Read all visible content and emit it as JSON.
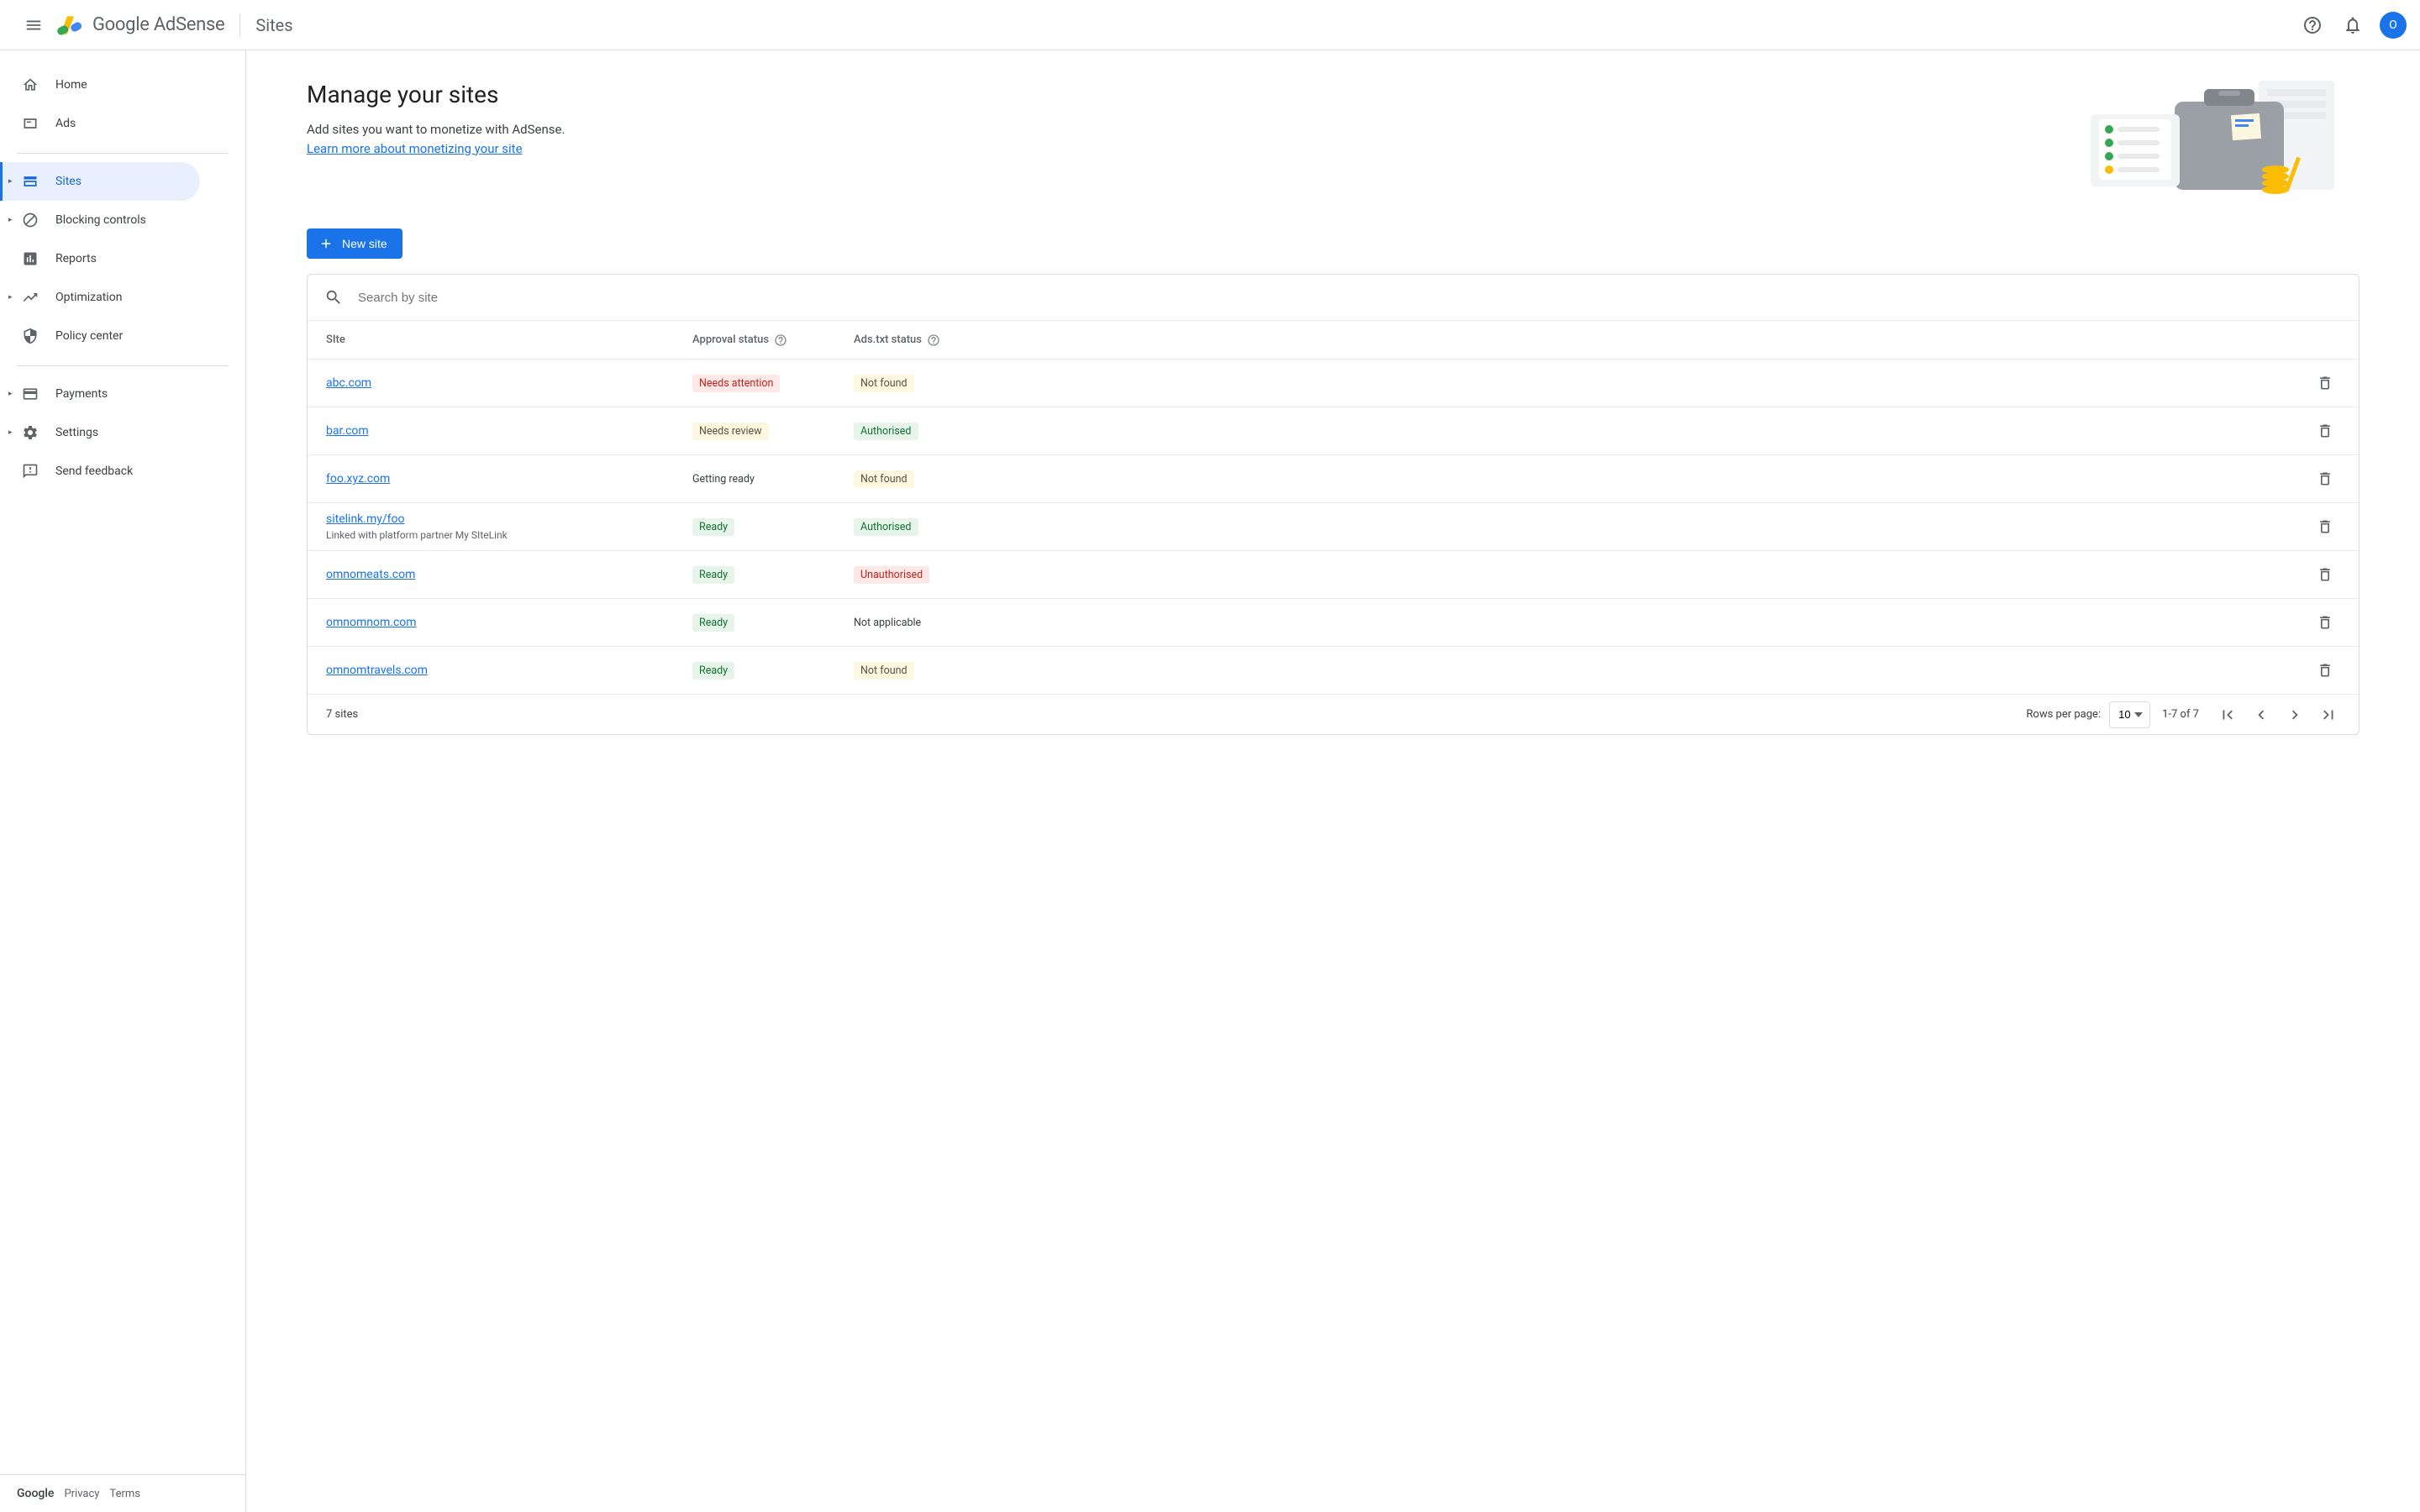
{
  "header": {
    "product_google": "Google",
    "product_name": "AdSense",
    "section": "Sites",
    "avatar_letter": "O"
  },
  "sidebar": {
    "items": [
      {
        "label": "Home"
      },
      {
        "label": "Ads"
      },
      {
        "label": "Sites"
      },
      {
        "label": "Blocking controls"
      },
      {
        "label": "Reports"
      },
      {
        "label": "Optimization"
      },
      {
        "label": "Policy center"
      },
      {
        "label": "Payments"
      },
      {
        "label": "Settings"
      },
      {
        "label": "Send feedback"
      }
    ],
    "footer": {
      "google": "Google",
      "privacy": "Privacy",
      "terms": "Terms"
    }
  },
  "hero": {
    "title": "Manage your sites",
    "subtitle": "Add sites you want to monetize with AdSense.",
    "link": "Learn more about monetizing your site"
  },
  "buttons": {
    "new_site": "New site"
  },
  "search": {
    "placeholder": "Search by site"
  },
  "table": {
    "headers": {
      "site": "SIte",
      "approval": "Approval status",
      "ads": "Ads.txt status"
    },
    "rows": [
      {
        "site": "abc.com",
        "subtitle": "",
        "approval": "Needs attention",
        "approval_class": "b-red",
        "ads": "Not found",
        "ads_class": "b-yellow"
      },
      {
        "site": "bar.com",
        "subtitle": "",
        "approval": "Needs review",
        "approval_class": "b-yellow",
        "ads": "Authorised",
        "ads_class": "b-green"
      },
      {
        "site": "foo.xyz.com",
        "subtitle": "",
        "approval": "Getting ready",
        "approval_class": "b-plain",
        "ads": "Not found",
        "ads_class": "b-yellow"
      },
      {
        "site": "sitelink.my/foo",
        "subtitle": "Linked with platform partner My SIteLink",
        "approval": "Ready",
        "approval_class": "b-green",
        "ads": "Authorised",
        "ads_class": "b-green"
      },
      {
        "site": "omnomeats.com",
        "subtitle": "",
        "approval": "Ready",
        "approval_class": "b-green",
        "ads": "Unauthorised",
        "ads_class": "b-red"
      },
      {
        "site": "omnomnom.com",
        "subtitle": "",
        "approval": "Ready",
        "approval_class": "b-green",
        "ads": "Not applicable",
        "ads_class": "b-plain"
      },
      {
        "site": "omnomtravels.com",
        "subtitle": "",
        "approval": "Ready",
        "approval_class": "b-green",
        "ads": "Not found",
        "ads_class": "b-yellow"
      }
    ],
    "footer": {
      "count": "7 sites",
      "rpp_label": "Rows per page:",
      "rpp_value": "10",
      "range": "1-7 of 7"
    }
  }
}
